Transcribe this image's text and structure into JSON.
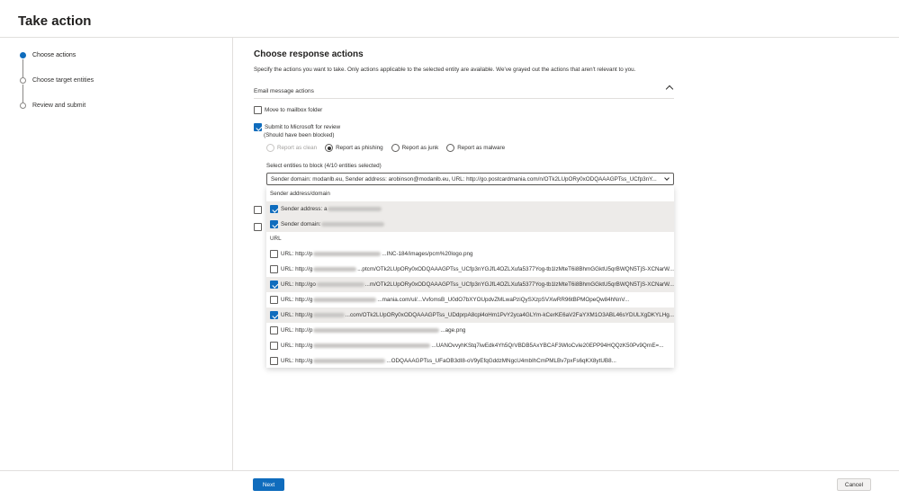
{
  "window": {
    "title": "Take action"
  },
  "steps": [
    {
      "label": "Choose actions",
      "active": true
    },
    {
      "label": "Choose target entities",
      "active": false
    },
    {
      "label": "Review and submit",
      "active": false
    }
  ],
  "main": {
    "heading": "Choose response actions",
    "description": "Specify the actions you want to take. Only actions applicable to the selected entity are available. We've grayed out the actions that aren't relevant to you.",
    "section_title": "Email message actions",
    "move_to_mailbox": {
      "label": "Move to mailbox folder",
      "checked": false
    },
    "submit_to_microsoft": {
      "label": "Submit to Microsoft for review",
      "checked": true,
      "sublabel": "(Should have been blocked)"
    },
    "report_options": [
      {
        "label": "Report as clean",
        "selected": false,
        "disabled": true
      },
      {
        "label": "Report as phishing",
        "selected": true,
        "disabled": false
      },
      {
        "label": "Report as junk",
        "selected": false,
        "disabled": false
      },
      {
        "label": "Report as malware",
        "selected": false,
        "disabled": false
      }
    ],
    "select_entities_label": "Select entities to block (4/10 entities selected)",
    "dropdown_value": "Sender domain: modanlb.eu, Sender address: arobinson@modanlb.eu, URL: http://go.postcardmania.com/n/OTk2LUpORy0xODQAAAGPTss_UCfp3nY...",
    "groups": {
      "sender": "Sender address/domain",
      "url": "URL"
    },
    "sender_options": [
      {
        "prefix": "Sender address: a",
        "suffix": "",
        "checked": true
      },
      {
        "prefix": "Sender domain: ",
        "suffix": "",
        "checked": true
      }
    ],
    "url_options": [
      {
        "prefix": "URL: http://p",
        "suffix": "...INC-184/images/pcm%20logo.png",
        "checked": false
      },
      {
        "prefix": "URL: http://g",
        "suffix": "...ptcm/OTk2LUpORy0xODQAAAGPTss_UCfp3nYGJfL4OZLXufa5377Yog-tb1lzMteT6i8BhmGGktU5qrBWQN5TjS-XCNarW...",
        "checked": false
      },
      {
        "prefix": "URL: http://go",
        "suffix": "...m/OTk2LUpORy0xODQAAAGPTss_UCfp3nYGJfL4OZLXufa5377Yog-tb1lzMteT6i8BhmGGktU5qrBWQN5TjS-XCNarW...",
        "checked": true
      },
      {
        "prefix": "URL: http://g",
        "suffix": "...mania.com/ul/...VvfomsB_U0dO7bXYOUpdvZMLwaPziQySXzpSVXwRR96tBPMOpeQw84hNnV...",
        "checked": false
      },
      {
        "prefix": "URL: http://g",
        "suffix": "...com/OTk2LUpORy0xODQAAAGPTss_UDdprpA8cpl4oHm1PvY2yca4GLYm-kCerKE6aV2FaYXM1O3ABL46sYDULXgDKYLHg...",
        "checked": true
      },
      {
        "prefix": "URL: http://p",
        "suffix": "...age.png",
        "checked": false
      },
      {
        "prefix": "URL: http://g",
        "suffix": "...UANOvvyhKStq7iwEdk4Yh5QrVBDB5AxYBCAF3WloCvIe20EPP94HQQzK50Pv9QrnE=...",
        "checked": false
      },
      {
        "prefix": "URL: http://g",
        "suffix": "...ODQAAAGPTss_UFaOB3dI8-oV9yEfqGddzMNgcU4mbIhCmPMLBv7pxFs6qKX8ytUB8...",
        "checked": false
      }
    ]
  },
  "footer": {
    "next_label": "Next",
    "cancel_label": "Cancel"
  },
  "colors": {
    "accent": "#0f6cbd",
    "selected_row": "#edebe9"
  }
}
